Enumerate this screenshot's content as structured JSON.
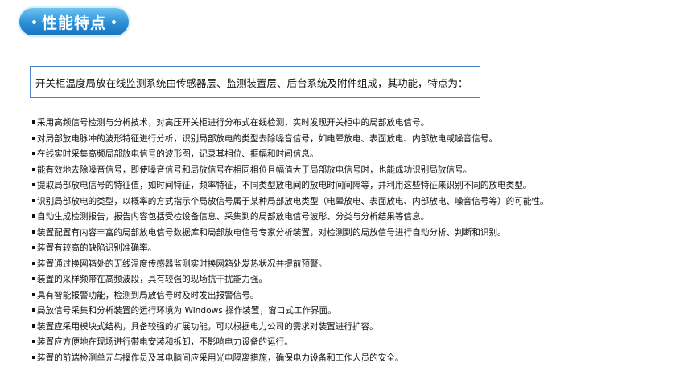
{
  "header": {
    "title": "性能特点"
  },
  "intro": "开关柜温度局放在线监测系统由传感器层、监测装置层、后台系统及附件组成，其功能，特点为：",
  "features": [
    "采用高频信号检测与分析技术，对高压开关柜进行分布式在线检测，实时发现开关柜中的局部放电信号。",
    "对局部放电脉冲的波形特征进行分析，识别局部放电的类型去除噪音信号，如电晕放电、表面放电、内部放电或噪音信号。",
    "在线实时采集高频局部放电信号的波形图，记录其相位、振幅和时间信息。",
    "能有效地去除噪音信号，即使噪音信号和局放信号在相同相位且幅值大于局部放电信号时，也能成功识别局放信号。",
    "提取局部放电信号的特征值，如时间特征，频率特征，不同类型放电间的放电时间间隔等，并利用这些特征来识别不同的放电类型。",
    "识别局部放电的类型，以概率的方式指示个局放信号属于某种局部放电类型（电晕放电、表面放电、内部放电、噪音信号等）的可能性。",
    "自动生成检测报告，报告内容包括受检设备信息、采集到的局部放电信号波形、分类与分析结果等信息。",
    "装置配置有内容丰富的局部放电信号数据库和局部放电信号专家分析装置，对检测到的局放信号进行自动分析、判断和识别。",
    "装置有较高的缺陷识别准确率。",
    "装置通过换网箱处的无线温度传感器监测实时换网箱处发热状况并提前预警。",
    "装置的采样频带在高频波段，具有较强的现场抗干扰能力强。",
    "具有智能报警功能，检测到局放信号时及时发出报警信号。",
    "局放信号采集和分析装置的运行环境为 Windows 操作装置，窗口式工作界面。",
    "装置应采用模块式结构，具备较强的扩展功能，可以根据电力公司的需求对装置进行扩容。",
    "装置应方便地在现场进行带电安装和拆卸，不影响电力设备的运行。",
    "装置的前端检测单元与操作员及其电脑间应采用光电隔离措施，确保电力设备和工作人员的安全。"
  ],
  "colors": {
    "badge_top": "#6fc3f2",
    "badge_bottom": "#1b72bd",
    "box_border": "#4a83c7"
  }
}
